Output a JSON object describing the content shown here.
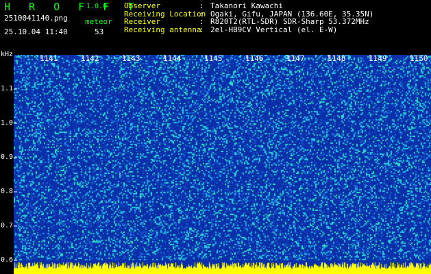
{
  "header": {
    "app_title": "H R O F F T",
    "app_version": "1.0.0",
    "filename": "2510041140.png",
    "datetime": "25.10.04 11:40",
    "meteor_label": "meteor",
    "meteor_count": "53"
  },
  "info": [
    {
      "key": "Observer",
      "sep": ":",
      "value": "Takanori Kawachi"
    },
    {
      "key": "Receiving Location",
      "sep": ":",
      "value": "Ogaki, Gifu, JAPAN (136.60E, 35.35N)"
    },
    {
      "key": "Receiver",
      "sep": ":",
      "value": "R820T2(RTL-SDR) SDR-Sharp 53.372MHz"
    },
    {
      "key": "Receiving antenna",
      "sep": ":",
      "value": "2el-HB9CV Vertical (el. E-W)"
    }
  ],
  "axis": {
    "y_unit": "kHz",
    "y_ticks": [
      "1.1",
      "1.0",
      "0.9",
      "0.8",
      "0.7",
      "0.6"
    ],
    "x_ticks": [
      "1141",
      "1142",
      "1143",
      "1144",
      "1145",
      "1146",
      "1147",
      "1148",
      "1149",
      "1150"
    ]
  },
  "colors": {
    "background": "#0a2fa8",
    "noise": "#21c8e8",
    "baseline": "#ffff00",
    "title": "#00ff00",
    "label": "#ffff00"
  }
}
